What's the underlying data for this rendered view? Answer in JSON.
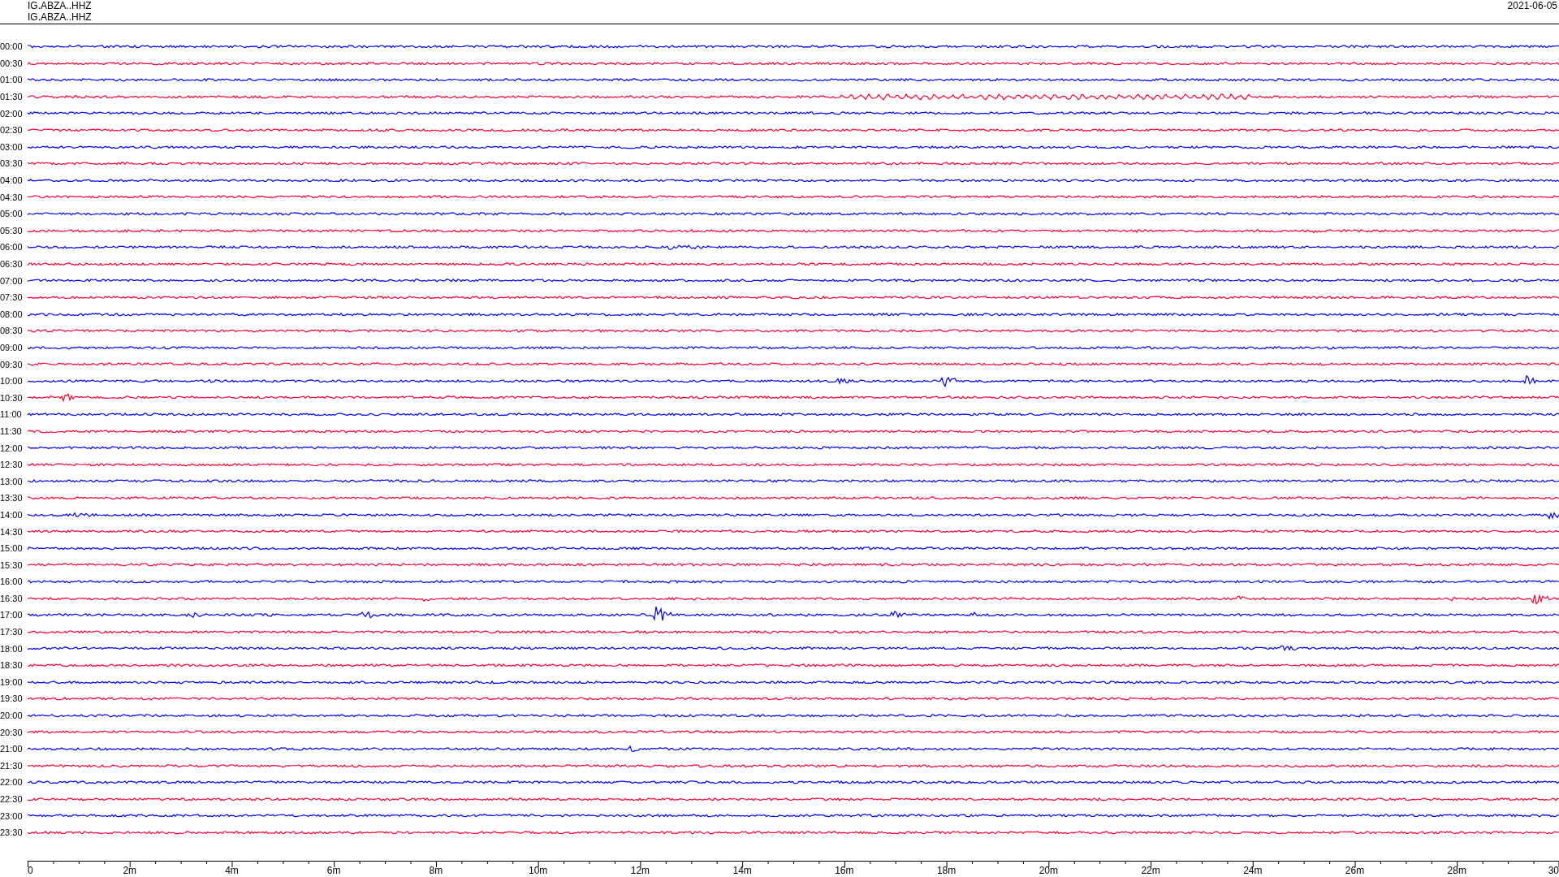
{
  "header": {
    "traces": [
      "IG.ABZA..HHZ",
      "IG.ABZA..HHZ"
    ],
    "date": "2021-06-05"
  },
  "helicorder": {
    "rows": [
      {
        "label": "00:00",
        "color": "#0000ff"
      },
      {
        "label": "00:30",
        "color": "#ff0033"
      },
      {
        "label": "01:00",
        "color": "#0000ff"
      },
      {
        "label": "01:30",
        "color": "#ff0033"
      },
      {
        "label": "02:00",
        "color": "#0000ff"
      },
      {
        "label": "02:30",
        "color": "#ff0033"
      },
      {
        "label": "03:00",
        "color": "#0000ff"
      },
      {
        "label": "03:30",
        "color": "#ff0033"
      },
      {
        "label": "04:00",
        "color": "#0000ff"
      },
      {
        "label": "04:30",
        "color": "#ff0033"
      },
      {
        "label": "05:00",
        "color": "#0000ff"
      },
      {
        "label": "05:30",
        "color": "#ff0033"
      },
      {
        "label": "06:00",
        "color": "#0000ff"
      },
      {
        "label": "06:30",
        "color": "#ff0033"
      },
      {
        "label": "07:00",
        "color": "#0000ff"
      },
      {
        "label": "07:30",
        "color": "#ff0033"
      },
      {
        "label": "08:00",
        "color": "#0000ff"
      },
      {
        "label": "08:30",
        "color": "#ff0033"
      },
      {
        "label": "09:00",
        "color": "#0000ff"
      },
      {
        "label": "09:30",
        "color": "#ff0033"
      },
      {
        "label": "10:00",
        "color": "#0000ff"
      },
      {
        "label": "10:30",
        "color": "#ff0033"
      },
      {
        "label": "11:00",
        "color": "#0000ff"
      },
      {
        "label": "11:30",
        "color": "#ff0033"
      },
      {
        "label": "12:00",
        "color": "#0000ff"
      },
      {
        "label": "12:30",
        "color": "#ff0033"
      },
      {
        "label": "13:00",
        "color": "#0000ff"
      },
      {
        "label": "13:30",
        "color": "#ff0033"
      },
      {
        "label": "14:00",
        "color": "#0000ff"
      },
      {
        "label": "14:30",
        "color": "#ff0033"
      },
      {
        "label": "15:00",
        "color": "#0000ff"
      },
      {
        "label": "15:30",
        "color": "#ff0033"
      },
      {
        "label": "16:00",
        "color": "#0000ff"
      },
      {
        "label": "16:30",
        "color": "#ff0033"
      },
      {
        "label": "17:00",
        "color": "#0000ff"
      },
      {
        "label": "17:30",
        "color": "#ff0033"
      },
      {
        "label": "18:00",
        "color": "#0000ff"
      },
      {
        "label": "18:30",
        "color": "#ff0033"
      },
      {
        "label": "19:00",
        "color": "#0000ff"
      },
      {
        "label": "19:30",
        "color": "#ff0033"
      },
      {
        "label": "20:00",
        "color": "#0000ff"
      },
      {
        "label": "20:30",
        "color": "#ff0033"
      },
      {
        "label": "21:00",
        "color": "#0000ff"
      },
      {
        "label": "21:30",
        "color": "#ff0033"
      },
      {
        "label": "22:00",
        "color": "#0000ff"
      },
      {
        "label": "22:30",
        "color": "#ff0033"
      },
      {
        "label": "23:00",
        "color": "#0000ff"
      },
      {
        "label": "23:30",
        "color": "#ff0033"
      }
    ],
    "time_axis": {
      "ticks": [
        "0",
        "2m",
        "4m",
        "6m",
        "8m",
        "10m",
        "12m",
        "14m",
        "16m",
        "18m",
        "20m",
        "22m",
        "24m",
        "26m",
        "28m",
        "30"
      ]
    }
  }
}
